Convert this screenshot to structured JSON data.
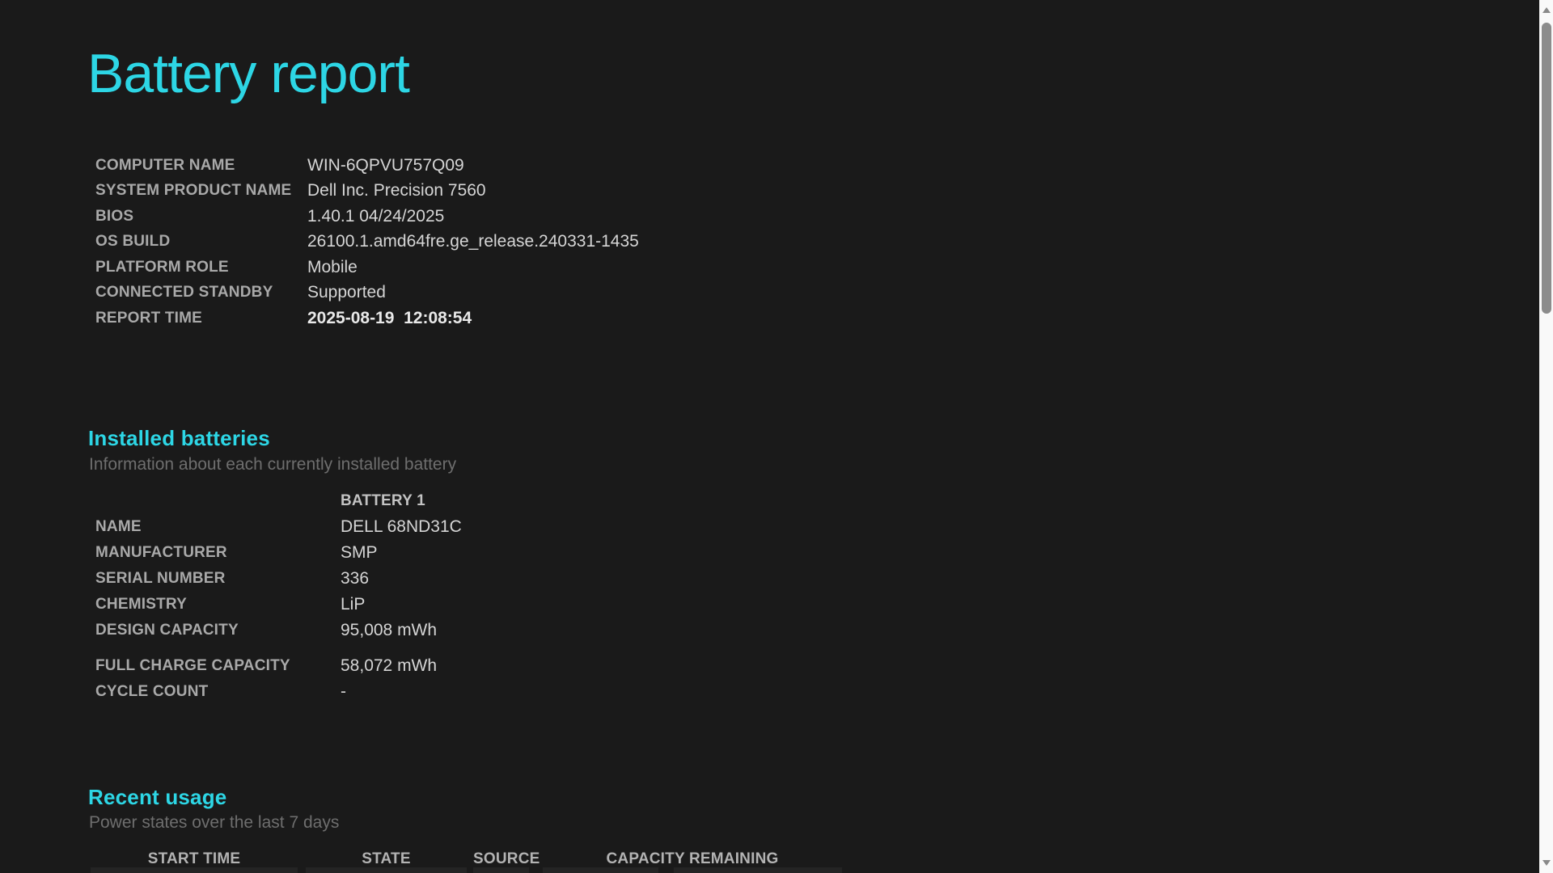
{
  "colors": {
    "background": "#1a1a1a",
    "accent_cyan": "#2dd6e5",
    "label_gray": "#a9a9a9",
    "value_gray": "#d5d5d5",
    "subtitle_gray": "#6e6e6e",
    "table_row_bg": "#242424",
    "scrollbar_track": "#f9f9f9",
    "scrollbar_thumb": "#8c8c8c"
  },
  "icons": {
    "scroll_up": "triangle-up",
    "scroll_down": "triangle-down"
  },
  "title": "Battery report",
  "system_info": {
    "rows": [
      {
        "label": "COMPUTER NAME",
        "value": "WIN-6QPVU757Q09"
      },
      {
        "label": "SYSTEM PRODUCT NAME",
        "value": "Dell Inc. Precision 7560"
      },
      {
        "label": "BIOS",
        "value": "1.40.1 04/24/2025"
      },
      {
        "label": "OS BUILD",
        "value": "26100.1.amd64fre.ge_release.240331-1435"
      },
      {
        "label": "PLATFORM ROLE",
        "value": "Mobile"
      },
      {
        "label": "CONNECTED STANDBY",
        "value": "Supported"
      },
      {
        "label": "REPORT TIME",
        "value": "2025-08-19  12:08:54"
      }
    ]
  },
  "installed_batteries": {
    "heading": "Installed batteries",
    "subtitle": "Information about each currently installed battery",
    "column_header": "BATTERY 1",
    "rows": [
      {
        "label": "NAME",
        "value": "DELL 68ND31C"
      },
      {
        "label": "MANUFACTURER",
        "value": "SMP"
      },
      {
        "label": "SERIAL NUMBER",
        "value": "336"
      },
      {
        "label": "CHEMISTRY",
        "value": "LiP"
      },
      {
        "label": "DESIGN CAPACITY",
        "value": "95,008 mWh"
      },
      {
        "label": "FULL CHARGE CAPACITY",
        "value": "58,072 mWh"
      },
      {
        "label": "CYCLE COUNT",
        "value": "-"
      }
    ]
  },
  "recent_usage": {
    "heading": "Recent usage",
    "subtitle": "Power states over the last 7 days",
    "columns": [
      "START TIME",
      "STATE",
      "SOURCE",
      "CAPACITY REMAINING"
    ]
  }
}
